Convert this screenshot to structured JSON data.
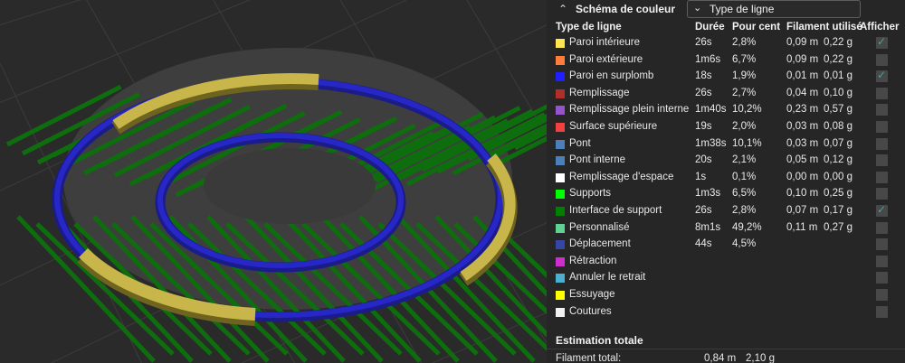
{
  "legend": {
    "title": "Schéma de couleur",
    "view_select": "Type de ligne",
    "headers": {
      "type": "Type de ligne",
      "duration": "Durée",
      "percent": "Pour cent",
      "filament": "Filament utilisé",
      "show": "Afficher"
    },
    "rows": [
      {
        "name": "Paroi intérieure",
        "color": "#ffe64d",
        "duration": "26s",
        "percent": "2,8%",
        "len": "0,09 m",
        "weight": "0,22 g",
        "checked": true
      },
      {
        "name": "Paroi extérieure",
        "color": "#ff7d38",
        "duration": "1m6s",
        "percent": "6,7%",
        "len": "0,09 m",
        "weight": "0,22 g",
        "checked": false
      },
      {
        "name": "Paroi en surplomb",
        "color": "#1f1fff",
        "duration": "18s",
        "percent": "1,9%",
        "len": "0,01 m",
        "weight": "0,01 g",
        "checked": true
      },
      {
        "name": "Remplissage",
        "color": "#b03029",
        "duration": "26s",
        "percent": "2,7%",
        "len": "0,04 m",
        "weight": "0,10 g",
        "checked": false
      },
      {
        "name": "Remplissage plein interne",
        "color": "#9654cc",
        "duration": "1m40s",
        "percent": "10,2%",
        "len": "0,23 m",
        "weight": "0,57 g",
        "checked": false
      },
      {
        "name": "Surface supérieure",
        "color": "#f04040",
        "duration": "19s",
        "percent": "2,0%",
        "len": "0,03 m",
        "weight": "0,08 g",
        "checked": false
      },
      {
        "name": "Pont",
        "color": "#4d80ba",
        "duration": "1m38s",
        "percent": "10,1%",
        "len": "0,03 m",
        "weight": "0,07 g",
        "checked": false
      },
      {
        "name": "Pont interne",
        "color": "#4d80ba",
        "duration": "20s",
        "percent": "2,1%",
        "len": "0,05 m",
        "weight": "0,12 g",
        "checked": false
      },
      {
        "name": "Remplissage d'espace",
        "color": "#ffffff",
        "duration": "1s",
        "percent": "0,1%",
        "len": "0,00 m",
        "weight": "0,00 g",
        "checked": false
      },
      {
        "name": "Supports",
        "color": "#00ff00",
        "duration": "1m3s",
        "percent": "6,5%",
        "len": "0,10 m",
        "weight": "0,25 g",
        "checked": false
      },
      {
        "name": "Interface de support",
        "color": "#008000",
        "duration": "26s",
        "percent": "2,8%",
        "len": "0,07 m",
        "weight": "0,17 g",
        "checked": true
      },
      {
        "name": "Personnalisé",
        "color": "#5ed194",
        "duration": "8m1s",
        "percent": "49,2%",
        "len": "0,11 m",
        "weight": "0,27 g",
        "checked": false
      },
      {
        "name": "Déplacement",
        "color": "#3845a8",
        "duration": "44s",
        "percent": "4,5%",
        "len": "",
        "weight": "",
        "checked": false
      },
      {
        "name": "Rétraction",
        "color": "#cc2fcc",
        "duration": "",
        "percent": "",
        "len": "",
        "weight": "",
        "checked": false
      },
      {
        "name": "Annuler le retrait",
        "color": "#4ab0d1",
        "duration": "",
        "percent": "",
        "len": "",
        "weight": "",
        "checked": false
      },
      {
        "name": "Essuyage",
        "color": "#ffff00",
        "duration": "",
        "percent": "",
        "len": "",
        "weight": "",
        "checked": false
      },
      {
        "name": "Coutures",
        "color": "#f2f2f2",
        "duration": "",
        "percent": "",
        "len": "",
        "weight": "",
        "checked": false
      }
    ],
    "estimation_title": "Estimation totale",
    "total_label": "Filament total:",
    "total_len": "0,84 m",
    "total_weight": "2,10 g"
  },
  "colors": {
    "support_green": "#0e6e0e",
    "overhang_blue": "#2222cc",
    "wall_yellow": "#c8b84a"
  }
}
